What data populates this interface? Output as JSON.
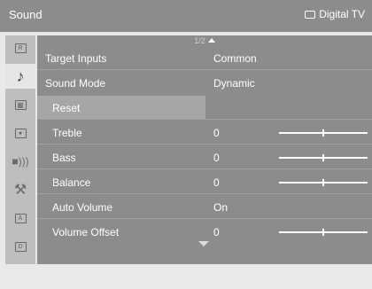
{
  "header": {
    "title": "Sound",
    "source_label": "Digital TV"
  },
  "page_indicator": "1/2",
  "sidebar": {
    "icons": [
      "picture-icon",
      "music-note-icon",
      "grid-icon",
      "camera-icon",
      "speaker-icon",
      "wrench-icon",
      "channel-a-icon",
      "channel-d-icon"
    ],
    "active_index": 1
  },
  "rows": [
    {
      "label": "Target Inputs",
      "value": "Common"
    },
    {
      "label": "Sound Mode",
      "value": "Dynamic"
    },
    {
      "label": "Reset",
      "value": ""
    },
    {
      "label": "Treble",
      "value": "0",
      "slider_level": 0.5
    },
    {
      "label": "Bass",
      "value": "0",
      "slider_level": 0.5
    },
    {
      "label": "Balance",
      "value": "0",
      "slider_level": 0.5
    },
    {
      "label": "Auto Volume",
      "value": "On"
    },
    {
      "label": "Volume Offset",
      "value": "0",
      "slider_level": 0.5
    }
  ]
}
